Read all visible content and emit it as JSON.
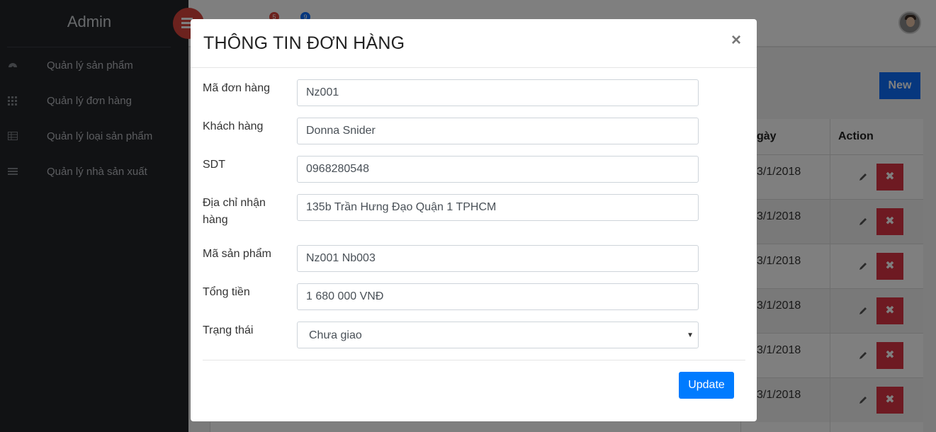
{
  "sidebar": {
    "brand": "Admin",
    "items": [
      {
        "label": "Quản lý sản phẩm",
        "icon": "dashboard-icon"
      },
      {
        "label": "Quản lý đơn hàng",
        "icon": "grid-icon"
      },
      {
        "label": "Quản lý loại sản phẩm",
        "icon": "table-icon"
      },
      {
        "label": "Quản lý nhà sản xuất",
        "icon": "list-icon"
      }
    ]
  },
  "topbar": {
    "badges": [
      "5",
      "9"
    ]
  },
  "main": {
    "new_label": "New",
    "columns": {
      "date": "gày",
      "action": "Action"
    },
    "rows": [
      {
        "date": "3/1/2018"
      },
      {
        "date": "3/1/2018"
      },
      {
        "date": "3/1/2018"
      },
      {
        "date": "3/1/2018"
      },
      {
        "date": "3/1/2018"
      },
      {
        "date": "3/1/2018"
      }
    ],
    "delete_glyph": "✖"
  },
  "modal": {
    "title": "THÔNG TIN ĐƠN HÀNG",
    "close": "×",
    "fields": [
      {
        "label": "Mã đơn hàng",
        "value": "Nz001"
      },
      {
        "label": "Khách hàng",
        "value": "Donna Snider"
      },
      {
        "label": "SDT",
        "value": "0968280548"
      },
      {
        "label": "Địa chỉ nhận hàng",
        "value": "135b Trần Hưng Đạo Quận 1 TPHCM"
      },
      {
        "label": "Mã sản phẩm",
        "value": "Nz001 Nb003"
      },
      {
        "label": "Tổng tiền",
        "value": "1 680 000 VNĐ"
      }
    ],
    "status": {
      "label": "Trạng thái",
      "selected": "Chưa giao"
    },
    "update_label": "Update"
  },
  "colors": {
    "sidebar_bg": "#222429",
    "accent_red": "#d9453d",
    "primary_blue": "#007bff",
    "danger": "#dc3545"
  }
}
